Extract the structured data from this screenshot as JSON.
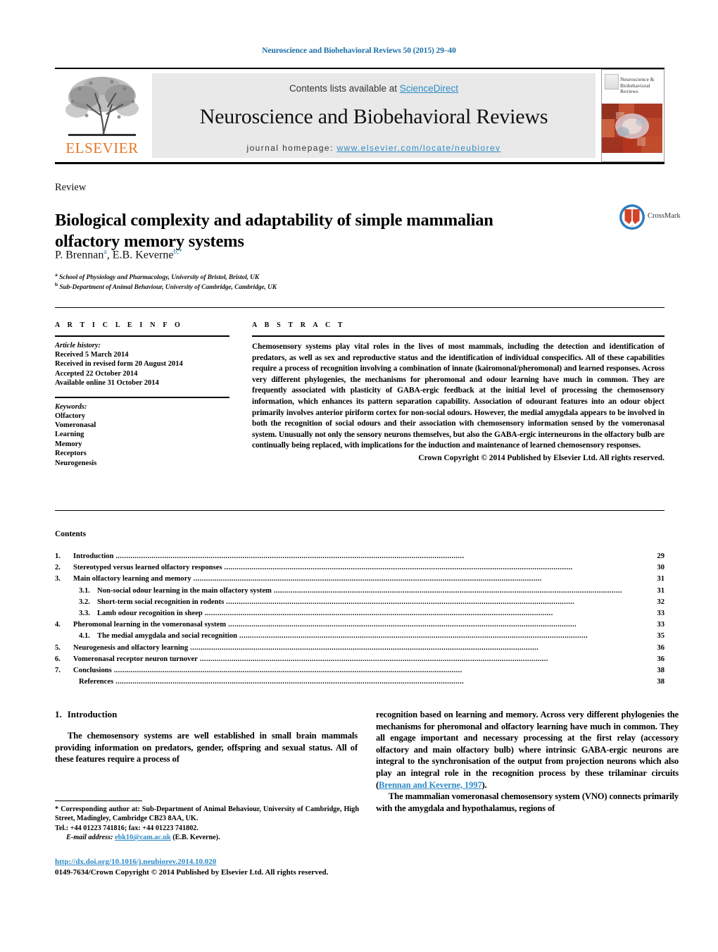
{
  "running_head": "Neuroscience and Biobehavioral Reviews 50 (2015) 29–40",
  "masthead": {
    "contents_prefix": "Contents lists available at ",
    "sciencedirect": "ScienceDirect",
    "journal_title": "Neuroscience and Biobehavioral Reviews",
    "homepage_label": "journal homepage:",
    "homepage_url": "www.elsevier.com/locate/neubiorev",
    "publisher": "ELSEVIER",
    "cover_title": "Neuroscience & Biobehavioral Reviews",
    "colors": {
      "link": "#2e8bc7",
      "elsevier_orange": "#E87722",
      "band": "#e9e9e9",
      "running_head": "#1a6fa8"
    }
  },
  "article": {
    "type": "Review",
    "title": "Biological complexity and adaptability of simple mammalian olfactory memory systems",
    "authors": "P. Brennan a, E.B. Keverne b,*",
    "author_parts": [
      {
        "name": "P. Brennan",
        "marks": "a"
      },
      {
        "name": "E.B. Keverne",
        "marks": "b,*"
      }
    ],
    "affiliations": [
      {
        "mark": "a",
        "text": "School of Physiology and Pharmacology, University of Bristol, Bristol, UK"
      },
      {
        "mark": "b",
        "text": "Sub-Department of Animal Behaviour, University of Cambridge, Cambridge, UK"
      }
    ],
    "crossmark_label": "CrossMark"
  },
  "info": {
    "heading": "A R T I C L E    I N F O",
    "history_label": "Article history:",
    "history": [
      "Received 5 March 2014",
      "Received in revised form 20 August 2014",
      "Accepted 22 October 2014",
      "Available online 31 October 2014"
    ],
    "keywords_label": "Keywords:",
    "keywords": [
      "Olfactory",
      "Vomeronasal",
      "Learning",
      "Memory",
      "Receptors",
      "Neurogenesis"
    ]
  },
  "abstract": {
    "heading": "A B S T R A C T",
    "text": "Chemosensory systems play vital roles in the lives of most mammals, including the detection and identification of predators, as well as sex and reproductive status and the identification of individual conspecifics. All of these capabilities require a process of recognition involving a combination of innate (kairomonal/pheromonal) and learned responses. Across very different phylogenies, the mechanisms for pheromonal and odour learning have much in common. They are frequently associated with plasticity of GABA-ergic feedback at the initial level of processing the chemosensory information, which enhances its pattern separation capability. Association of odourant features into an odour object primarily involves anterior piriform cortex for non-social odours. However, the medial amygdala appears to be involved in both the recognition of social odours and their association with chemosensory information sensed by the vomeronasal system. Unusually not only the sensory neurons themselves, but also the GABA-ergic interneurons in the olfactory bulb are continually being replaced, with implications for the induction and maintenance of learned chemosensory responses.",
    "copyright": "Crown Copyright © 2014 Published by Elsevier Ltd. All rights reserved."
  },
  "contents": {
    "heading": "Contents",
    "entries": [
      {
        "num": "1.",
        "sub": "",
        "label": "Introduction",
        "page": "29"
      },
      {
        "num": "2.",
        "sub": "",
        "label": "Stereotyped versus learned olfactory responses",
        "page": "30"
      },
      {
        "num": "3.",
        "sub": "",
        "label": "Main olfactory learning and memory",
        "page": "31"
      },
      {
        "num": "",
        "sub": "3.1.",
        "label": "Non-social odour learning in the main olfactory system",
        "page": "31"
      },
      {
        "num": "",
        "sub": "3.2.",
        "label": "Short-term social recognition in rodents",
        "page": "32"
      },
      {
        "num": "",
        "sub": "3.3.",
        "label": "Lamb odour recognition in sheep",
        "page": "33"
      },
      {
        "num": "4.",
        "sub": "",
        "label": "Pheromonal learning in the vomeronasal system",
        "page": "33"
      },
      {
        "num": "",
        "sub": "4.1.",
        "label": "The medial amygdala and social recognition",
        "page": "35"
      },
      {
        "num": "5.",
        "sub": "",
        "label": "Neurogenesis and olfactory learning",
        "page": "36"
      },
      {
        "num": "6.",
        "sub": "",
        "label": "Vomeronasal receptor neuron turnover",
        "page": "36"
      },
      {
        "num": "7.",
        "sub": "",
        "label": "Conclusions",
        "page": "38"
      },
      {
        "num": "",
        "sub": "",
        "label": "References",
        "page": "38"
      }
    ]
  },
  "body": {
    "intro_num": "1.",
    "intro_heading": "Introduction",
    "left_para_1": "The chemosensory systems are well established in small brain mammals providing information on predators, gender, offspring and sexual status. All of these features require a process of",
    "right_para_1a": "recognition based on learning and memory. Across very different phylogenies the mechanisms for pheromonal and olfactory learning have much in common. They all engage important and necessary processing at the first relay (accessory olfactory and main olfactory bulb) where intrinsic GABA-ergic neurons are integral to the synchronisation of the output from projection neurons which also play an integral role in the recognition process by these trilaminar circuits (",
    "right_para_1_cite": "Brennan and Keverne, 1997",
    "right_para_1b": ").",
    "right_para_2": "The mammalian vomeronasal chemosensory system (VNO) connects primarily with the amygdala and hypothalamus, regions of"
  },
  "footnote": {
    "star": "*",
    "text": "Corresponding author at: Sub-Department of Animal Behaviour, University of Cambridge, High Street, Madingley, Cambridge CB23 8AA, UK.",
    "tel": "Tel.: +44 01223 741816; fax: +44 01223 741802.",
    "email_label": "E-mail address:",
    "email": "ebk10@cam.ac.uk",
    "email_suffix": "(E.B. Keverne).",
    "doi": "http://dx.doi.org/10.1016/j.neubiorev.2014.10.020",
    "issn_line": "0149-7634/Crown Copyright © 2014 Published by Elsevier Ltd. All rights reserved."
  }
}
